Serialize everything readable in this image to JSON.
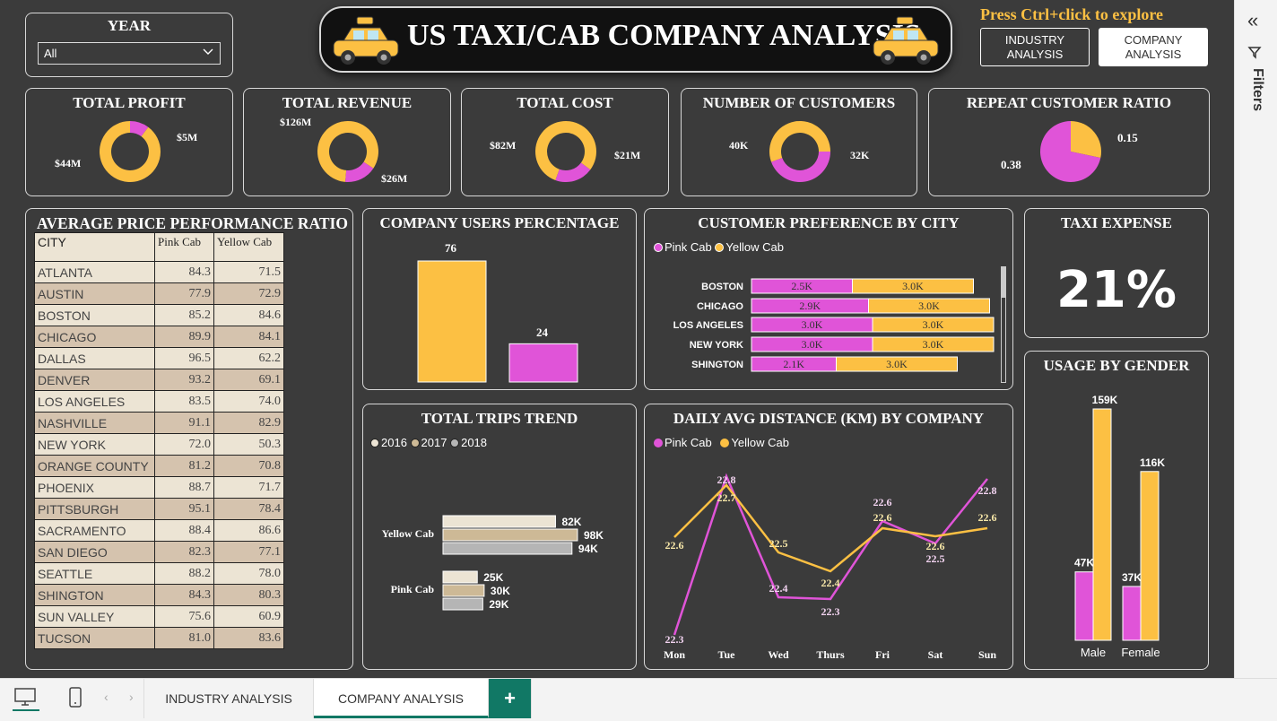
{
  "header": {
    "title": "US TAXI/CAB COMPANY ANALYSIS",
    "hint": "Press Ctrl+click to explore",
    "nav": [
      {
        "label_1": "INDUSTRY",
        "label_2": "ANALYSIS"
      },
      {
        "label_1": "COMPANY",
        "label_2": "ANALYSIS"
      }
    ]
  },
  "year_filter": {
    "label": "YEAR",
    "value": "All"
  },
  "kpis": {
    "profit": {
      "title": "TOTAL PROFIT",
      "label_a": "$5M",
      "label_b": "$44M"
    },
    "revenue": {
      "title": "TOTAL REVENUE",
      "label_a": "$126M",
      "label_b": "$26M"
    },
    "cost": {
      "title": "TOTAL COST",
      "label_a": "$82M",
      "label_b": "$21M"
    },
    "customers": {
      "title": "NUMBER OF CUSTOMERS",
      "label_a": "40K",
      "label_b": "32K"
    },
    "repeat": {
      "title": "REPEAT CUSTOMER RATIO",
      "label_a": "0.15",
      "label_b": "0.38"
    }
  },
  "price_table": {
    "title": "AVERAGE PRICE PERFORMANCE RATIO",
    "headers": [
      "CITY",
      "Pink Cab",
      "Yellow Cab"
    ],
    "rows": [
      [
        "ATLANTA",
        "84.3",
        "71.5"
      ],
      [
        "AUSTIN",
        "77.9",
        "72.9"
      ],
      [
        "BOSTON",
        "85.2",
        "84.6"
      ],
      [
        "CHICAGO",
        "89.9",
        "84.1"
      ],
      [
        "DALLAS",
        "96.5",
        "62.2"
      ],
      [
        "DENVER",
        "93.2",
        "69.1"
      ],
      [
        "LOS ANGELES",
        "83.5",
        "74.0"
      ],
      [
        "NASHVILLE",
        "91.1",
        "82.9"
      ],
      [
        "NEW YORK",
        "72.0",
        "50.3"
      ],
      [
        "ORANGE COUNTY",
        "81.2",
        "70.8"
      ],
      [
        "PHOENIX",
        "88.7",
        "71.7"
      ],
      [
        "PITTSBURGH",
        "95.1",
        "78.4"
      ],
      [
        "SACRAMENTO",
        "88.4",
        "86.6"
      ],
      [
        "SAN DIEGO",
        "82.3",
        "77.1"
      ],
      [
        "SEATTLE",
        "88.2",
        "78.0"
      ],
      [
        "SHINGTON",
        "84.3",
        "80.3"
      ],
      [
        "SUN VALLEY",
        "75.6",
        "60.9"
      ],
      [
        "TUCSON",
        "81.0",
        "83.6"
      ]
    ]
  },
  "taxi_expense": {
    "title": "TAXI EXPENSE",
    "value": "21%"
  },
  "colors": {
    "pink": "#e054d8",
    "yellow": "#fcc043",
    "bg": "#3b3b3b",
    "beige1": "#ece4d4",
    "beige2": "#d5c3ae",
    "gray": "#b5b5b5"
  },
  "chart_data": [
    {
      "type": "pie",
      "title": "TOTAL PROFIT",
      "style": "donut",
      "categories": [
        "Pink Cab",
        "Yellow Cab"
      ],
      "labels": [
        "$5M",
        "$44M"
      ],
      "values": [
        5,
        44
      ]
    },
    {
      "type": "pie",
      "title": "TOTAL REVENUE",
      "style": "donut",
      "categories": [
        "Yellow Cab",
        "Pink Cab"
      ],
      "labels": [
        "$126M",
        "$26M"
      ],
      "values": [
        126,
        26
      ]
    },
    {
      "type": "pie",
      "title": "TOTAL COST",
      "style": "donut",
      "categories": [
        "Yellow Cab",
        "Pink Cab"
      ],
      "labels": [
        "$82M",
        "$21M"
      ],
      "values": [
        82,
        21
      ]
    },
    {
      "type": "pie",
      "title": "NUMBER OF CUSTOMERS",
      "style": "donut",
      "categories": [
        "Yellow Cab",
        "Pink Cab"
      ],
      "labels": [
        "40K",
        "32K"
      ],
      "values": [
        40,
        32
      ]
    },
    {
      "type": "pie",
      "title": "REPEAT CUSTOMER RATIO",
      "categories": [
        "Yellow Cab",
        "Pink Cab"
      ],
      "labels": [
        "0.15",
        "0.38"
      ],
      "values": [
        0.15,
        0.38
      ]
    },
    {
      "type": "bar",
      "title": "COMPANY USERS PERCENTAGE",
      "categories": [
        "Yellow Cab",
        "Pink Cab"
      ],
      "values": [
        76,
        24
      ],
      "ylim": [
        0,
        76
      ]
    },
    {
      "type": "bar",
      "orientation": "horizontal",
      "stacked": true,
      "title": "CUSTOMER PREFERENCE BY CITY",
      "legend": "top-left",
      "categories": [
        "BOSTON",
        "CHICAGO",
        "LOS ANGELES",
        "NEW YORK",
        "SHINGTON"
      ],
      "series": [
        {
          "name": "Pink Cab",
          "values": [
            2.5,
            2.9,
            3.0,
            3.0,
            2.1
          ],
          "labels": [
            "2.5K",
            "2.9K",
            "3.0K",
            "3.0K",
            "2.1K"
          ]
        },
        {
          "name": "Yellow Cab",
          "values": [
            3.0,
            3.0,
            3.0,
            3.0,
            3.0
          ],
          "labels": [
            "3.0K",
            "3.0K",
            "3.0K",
            "3.0K",
            "3.0K"
          ]
        }
      ]
    },
    {
      "type": "bar",
      "orientation": "horizontal",
      "title": "TOTAL TRIPS TREND",
      "legend": "top-left",
      "categories": [
        "Yellow Cab",
        "Pink Cab"
      ],
      "series": [
        {
          "name": "2016",
          "values": [
            82,
            25
          ],
          "labels": [
            "82K",
            "25K"
          ]
        },
        {
          "name": "2017",
          "values": [
            98,
            30
          ],
          "labels": [
            "98K",
            "30K"
          ]
        },
        {
          "name": "2018",
          "values": [
            94,
            29
          ],
          "labels": [
            "94K",
            "29K"
          ]
        }
      ]
    },
    {
      "type": "line",
      "title": "DAILY AVG DISTANCE (KM) BY COMPANY",
      "legend": "top-left",
      "x": [
        "Mon",
        "Tue",
        "Wed",
        "Thurs",
        "Fri",
        "Sat",
        "Sun"
      ],
      "series": [
        {
          "name": "Pink Cab",
          "values": [
            22.3,
            22.8,
            22.4,
            22.3,
            22.6,
            22.5,
            22.8
          ]
        },
        {
          "name": "Yellow Cab",
          "values": [
            22.6,
            22.7,
            22.5,
            22.4,
            22.6,
            22.6,
            22.6
          ]
        }
      ]
    },
    {
      "type": "bar",
      "title": "USAGE BY GENDER",
      "categories": [
        "Male",
        "Female"
      ],
      "series": [
        {
          "name": "Pink Cab",
          "values": [
            47,
            37
          ],
          "labels": [
            "47K",
            "37K"
          ]
        },
        {
          "name": "Yellow Cab",
          "values": [
            159,
            116
          ],
          "labels": [
            "159K",
            "116K"
          ]
        }
      ]
    }
  ],
  "chart_text": {
    "users": {
      "title": "COMPANY USERS PERCENTAGE",
      "v1": "76",
      "v2": "24"
    },
    "city": {
      "title": "CUSTOMER PREFERENCE BY CITY",
      "legend_pink": "Pink Cab",
      "legend_yellow": "Yellow Cab"
    },
    "trips": {
      "title": "TOTAL TRIPS TREND",
      "legend": [
        "2016",
        "2017",
        "2018"
      ]
    },
    "distance": {
      "title": "DAILY AVG DISTANCE (KM) BY COMPANY",
      "legend_pink": "Pink Cab",
      "legend_yellow": "Yellow Cab"
    },
    "gender": {
      "title": "USAGE BY GENDER"
    }
  },
  "filters_pane": {
    "label": "Filters"
  },
  "bottom_tabs": {
    "tab1": "INDUSTRY ANALYSIS",
    "tab2": "COMPANY ANALYSIS",
    "add": "+"
  }
}
